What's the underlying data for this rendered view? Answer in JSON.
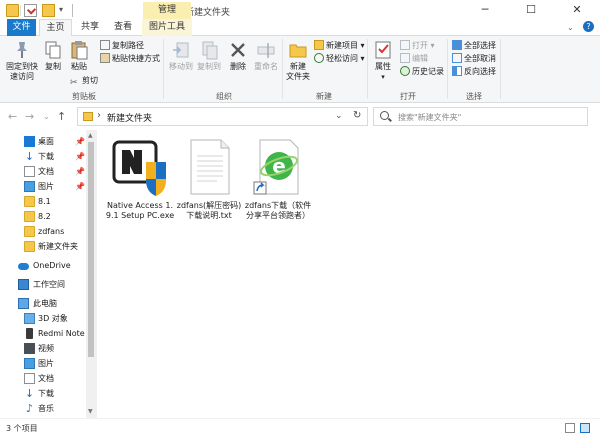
{
  "window": {
    "title": "新建文件夹",
    "minimize": "─",
    "maximize": "☐",
    "close": "✕"
  },
  "tabs": {
    "manage_context": "管理",
    "file": "文件",
    "home": "主页",
    "share": "共享",
    "view": "查看",
    "picture_tools": "图片工具"
  },
  "ribbon": {
    "clipboard": {
      "group": "剪贴板",
      "pin_quick_access": "固定到快\n速访问",
      "copy": "复制",
      "paste": "粘贴",
      "cut": "剪切",
      "copy_path": "复制路径",
      "paste_shortcut": "粘贴快捷方式"
    },
    "organize": {
      "group": "组织",
      "move_to": "移动到",
      "copy_to": "复制到",
      "delete": "删除",
      "rename": "重命名"
    },
    "new": {
      "group": "新建",
      "new_folder": "新建\n文件夹",
      "new_item": "新建项目",
      "easy_access": "轻松访问"
    },
    "open": {
      "group": "打开",
      "properties": "属性",
      "open": "打开",
      "edit": "编辑",
      "history": "历史记录"
    },
    "select": {
      "group": "选择",
      "select_all": "全部选择",
      "select_none": "全部取消",
      "invert": "反向选择"
    }
  },
  "address": {
    "path": "新建文件夹",
    "search_placeholder": "搜索\"新建文件夹\""
  },
  "nav_pane": {
    "items": [
      {
        "label": "桌面",
        "icon": "desktop-icon",
        "pinned": true
      },
      {
        "label": "下载",
        "icon": "download-icon",
        "pinned": true
      },
      {
        "label": "文档",
        "icon": "documents-icon",
        "pinned": true
      },
      {
        "label": "图片",
        "icon": "pictures-icon",
        "pinned": true
      },
      {
        "label": "8.1",
        "icon": "folder-icon"
      },
      {
        "label": "8.2",
        "icon": "folder-icon"
      },
      {
        "label": "zdfans",
        "icon": "folder-icon"
      },
      {
        "label": "新建文件夹",
        "icon": "folder-icon"
      },
      {
        "label": "OneDrive",
        "icon": "onedrive-icon"
      },
      {
        "label": "工作空间",
        "icon": "network-icon"
      },
      {
        "label": "此电脑",
        "icon": "pc-icon"
      },
      {
        "label": "3D 对象",
        "icon": "3d-objects-icon"
      },
      {
        "label": "Redmi Note",
        "icon": "phone-icon"
      },
      {
        "label": "视频",
        "icon": "videos-icon"
      },
      {
        "label": "图片",
        "icon": "pictures-icon"
      },
      {
        "label": "文档",
        "icon": "documents-icon"
      },
      {
        "label": "下载",
        "icon": "download-icon"
      },
      {
        "label": "音乐",
        "icon": "music-icon"
      }
    ]
  },
  "files": [
    {
      "name": "Native Access 1.9.1 Setup PC.exe",
      "icon": "installer-icon"
    },
    {
      "name": "zdfans(解压密码)下载说明.txt",
      "icon": "text-file-icon"
    },
    {
      "name": "zdfans下载（软件分享平台领跑者）",
      "icon": "shortcut-icon"
    }
  ],
  "status": {
    "item_count": "3 个项目"
  },
  "colors": {
    "accent": "#1979ca",
    "context_tab": "#fbeeb1",
    "ribbon_bg": "#f5f6f7"
  }
}
